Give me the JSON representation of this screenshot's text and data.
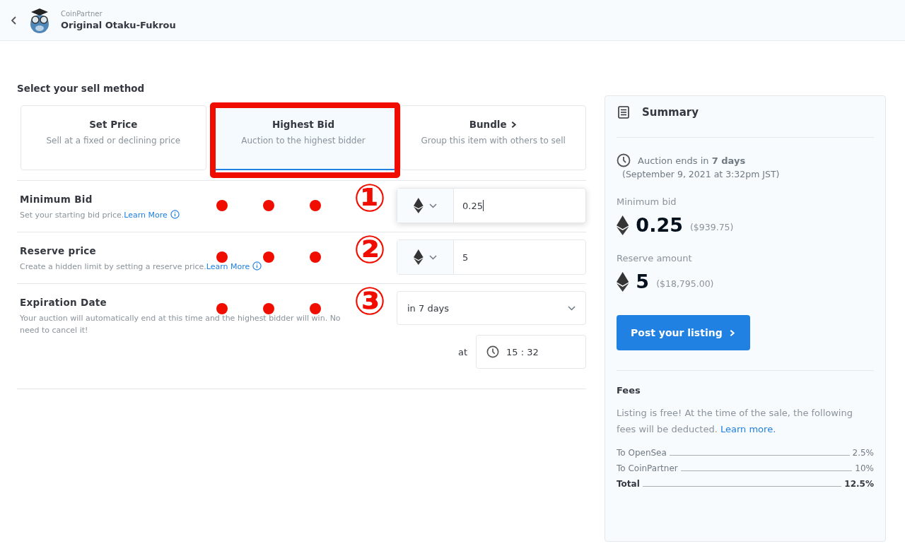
{
  "header": {
    "brand": "CoinPartner",
    "title": "Original Otaku-Fukrou"
  },
  "sell_method": {
    "heading": "Select your sell method",
    "methods": [
      {
        "title": "Set Price",
        "description": "Sell at a fixed or declining price",
        "selected": false,
        "highlighted": false,
        "chevron": false
      },
      {
        "title": "Highest Bid",
        "description": "Auction to the highest bidder",
        "selected": true,
        "highlighted": true,
        "chevron": false
      },
      {
        "title": "Bundle",
        "description": "Group this item with others to sell",
        "selected": false,
        "highlighted": false,
        "chevron": true
      }
    ]
  },
  "fields": [
    {
      "kind": "price",
      "label": "Minimum Bid",
      "description": "Set your starting bid price.",
      "link": "Learn More",
      "value": "0.25",
      "focused": true,
      "annotation": "①"
    },
    {
      "kind": "price",
      "label": "Reserve price",
      "description": "Create a hidden limit by setting a reserve price.",
      "link": "Learn More",
      "value": "5",
      "focused": false,
      "annotation": "②"
    },
    {
      "kind": "date",
      "label": "Expiration Date",
      "description": "Your auction will automatically end at this time and the highest bidder will win. No need to cancel it!",
      "value": "in 7 days",
      "time_prefix": "at",
      "time": "15 : 32",
      "annotation": "③"
    }
  ],
  "summary": {
    "title": "Summary",
    "auction_end": "Auction ends in **7 days**",
    "auction_date": "(September 9, 2021 at 3:32pm JST)",
    "amounts": [
      {
        "label": "Minimum bid",
        "value": "0.25",
        "usd": "($939.75)"
      },
      {
        "label": "Reserve amount",
        "value": "5",
        "usd": "($18,795.00)"
      }
    ],
    "button": "Post your listing",
    "fees_title": "Fees",
    "fees_text": "Listing is free! At the time of the sale, the following fees will be deducted.",
    "fees_link": "Learn more.",
    "fees": [
      {
        "name": "To OpenSea",
        "value": "2.5%",
        "total": false
      },
      {
        "name": "To CoinPartner",
        "value": "10%",
        "total": false
      },
      {
        "name": "Total",
        "value": "12.5%",
        "total": true
      }
    ]
  }
}
